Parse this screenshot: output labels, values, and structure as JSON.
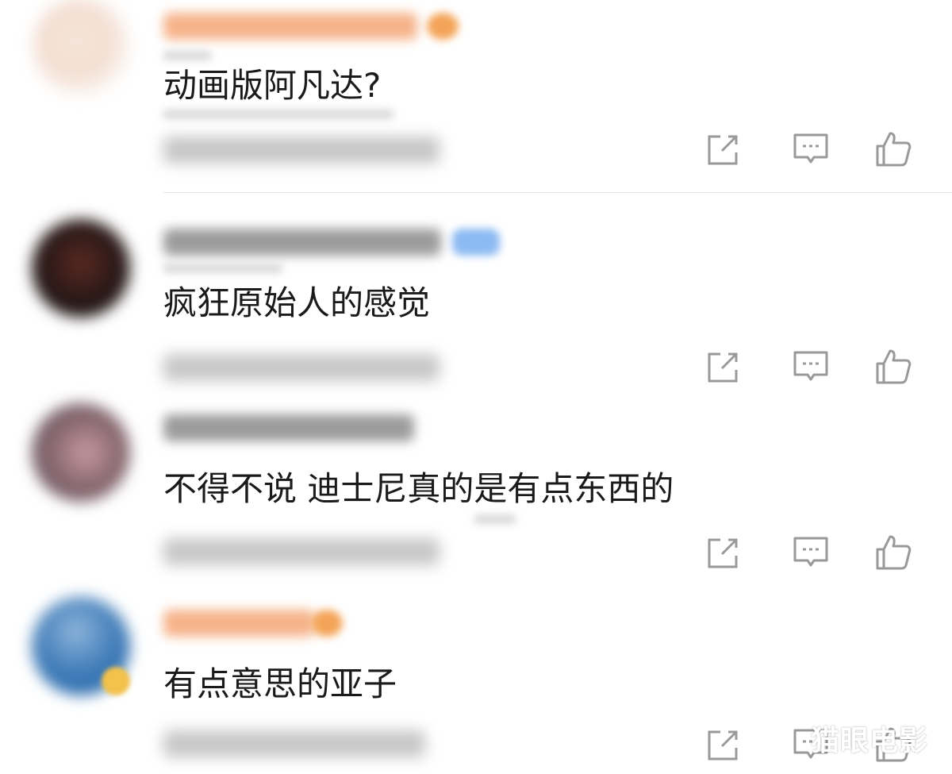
{
  "comments": [
    {
      "text": "动画版阿凡达?"
    },
    {
      "text": "疯狂原始人的感觉"
    },
    {
      "text": "不得不说 迪士尼真的是有点东西的"
    },
    {
      "text": "有点意思的亚子"
    }
  ],
  "icons": {
    "share": "share-icon",
    "reply": "comment-icon",
    "like": "thumbs-up-icon"
  },
  "colors": {
    "text": "#1a1a1a",
    "icon": "#999999",
    "username_blur_orange": "#f6b38a",
    "vip_blue": "#8cbaf2"
  },
  "watermark": "猫眼电影"
}
